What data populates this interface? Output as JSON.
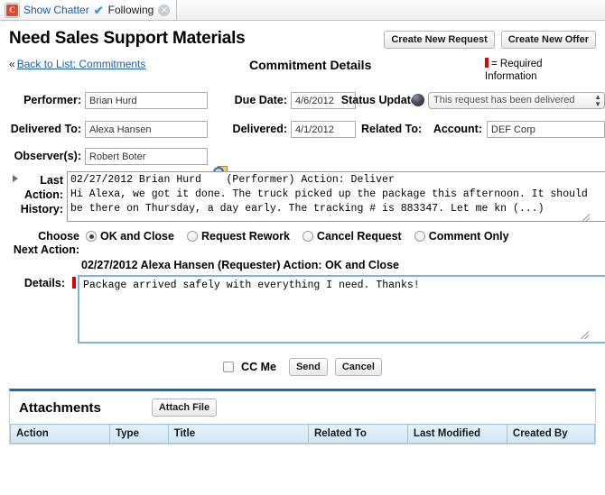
{
  "chatter": {
    "logo_letter": "C",
    "show_chatter": "Show Chatter",
    "following": "Following",
    "close": "×"
  },
  "header": {
    "title": "Need Sales Support Materials",
    "create_request_label": "Create New Request",
    "create_offer_label": "Create New Offer",
    "back_chevron": "«",
    "back_link": "Back to List: Commitments",
    "details_heading": "Commitment Details",
    "required_legend": "= Required Information"
  },
  "form": {
    "performer_label": "Performer:",
    "performer_value": "Brian Hurd",
    "due_date_label": "Due Date:",
    "due_date_value": "4/6/2012",
    "status_update_label": "Status Update:",
    "status_update_value": "This request has been delivered",
    "delivered_to_label": "Delivered To:",
    "delivered_to_value": "Alexa Hansen",
    "delivered_label": "Delivered:",
    "delivered_value": "4/1/2012",
    "related_to_label": "Related To:",
    "account_label": "Account:",
    "account_value": "DEF Corp",
    "observers_label": "Observer(s):",
    "observers_value": "Robert Boter"
  },
  "history": {
    "label_line1": "Last",
    "label_line2": "Action:",
    "label_line3": "History:",
    "text": "02/27/2012 Brian Hurd    (Performer) Action: Deliver\nHi Alexa, we got it done. The truck picked up the package this afternoon. It should\nbe there on Thursday, a day early. The tracking # is 883347. Let me kn (...)"
  },
  "next_action": {
    "label_line1": "Choose",
    "label_line2": "Next Action:",
    "options": [
      {
        "label": "OK and Close",
        "selected": true
      },
      {
        "label": "Request Rework",
        "selected": false
      },
      {
        "label": "Cancel Request",
        "selected": false
      },
      {
        "label": "Comment Only",
        "selected": false
      }
    ]
  },
  "details": {
    "header": "02/27/2012 Alexa Hansen    (Requester) Action: OK and Close",
    "label": "Details:",
    "value": "Package arrived safely with everything I need. Thanks!"
  },
  "actions": {
    "cc_me_label": "CC Me",
    "cc_me_checked": false,
    "send_label": "Send",
    "cancel_label": "Cancel"
  },
  "attachments": {
    "title": "Attachments",
    "attach_file_label": "Attach File",
    "columns": [
      "Action",
      "Type",
      "Title",
      "Related To",
      "Last Modified",
      "Created By"
    ],
    "rows": []
  }
}
